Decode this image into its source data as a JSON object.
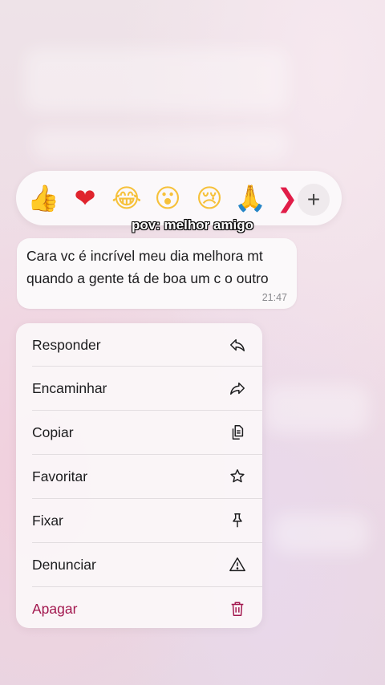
{
  "reactions": [
    {
      "name": "thumbs-up-icon",
      "glyph": "👍",
      "cls": "like"
    },
    {
      "name": "heart-icon",
      "glyph": "❤",
      "cls": "heart"
    },
    {
      "name": "laughing-face-icon",
      "glyph": "😂",
      "cls": "face"
    },
    {
      "name": "surprised-face-icon",
      "glyph": "😮",
      "cls": "face"
    },
    {
      "name": "crying-face-icon",
      "glyph": "😢",
      "cls": "face"
    },
    {
      "name": "praying-hands-icon",
      "glyph": "🙏",
      "cls": "pray"
    }
  ],
  "reaction_more_glyph": "❯",
  "plus_glyph": "+",
  "caption": "pov: melhor amigo",
  "message": {
    "text": "Cara vc é incrível meu dia melhora mt quando a gente tá de boa um c o outro",
    "time": "21:47"
  },
  "menu": {
    "reply": "Responder",
    "forward": "Encaminhar",
    "copy": "Copiar",
    "favorite": "Favoritar",
    "pin": "Fixar",
    "report": "Denunciar",
    "delete": "Apagar"
  },
  "colors": {
    "delete_accent": "#a2174e",
    "background": "#ecdde5"
  }
}
